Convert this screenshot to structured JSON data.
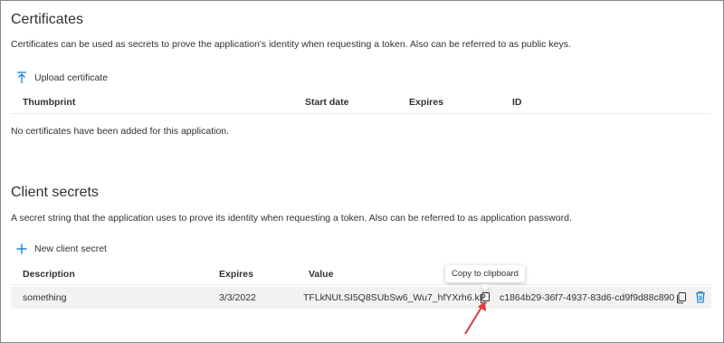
{
  "certificates": {
    "title": "Certificates",
    "description": "Certificates can be used as secrets to prove the application's identity when requesting a token. Also can be referred to as public keys.",
    "upload_label": "Upload certificate",
    "columns": {
      "thumbprint": "Thumbprint",
      "start_date": "Start date",
      "expires": "Expires",
      "id": "ID"
    },
    "empty_message": "No certificates have been added for this application."
  },
  "client_secrets": {
    "title": "Client secrets",
    "description": "A secret string that the application uses to prove its identity when requesting a token. Also can be referred to as application password.",
    "new_label": "New client secret",
    "columns": {
      "description": "Description",
      "expires": "Expires",
      "value": "Value"
    },
    "rows": [
      {
        "description": "something",
        "expires": "3/3/2022",
        "value": "TFLkNUt.SI5Q8SUbSw6_Wu7_hfYXrh6.kP",
        "secret_id": "c1864b29-36f7-4937-83d6-cd9f9d88c890"
      }
    ],
    "tooltip": "Copy to clipboard"
  },
  "icons": {
    "upload": "upload-icon",
    "add": "plus-icon",
    "copy": "copy-icon",
    "delete": "trash-icon"
  },
  "colors": {
    "accent": "#0078d4",
    "annotation_arrow": "#e03a3a",
    "row_highlight": "#f3f2f1"
  }
}
